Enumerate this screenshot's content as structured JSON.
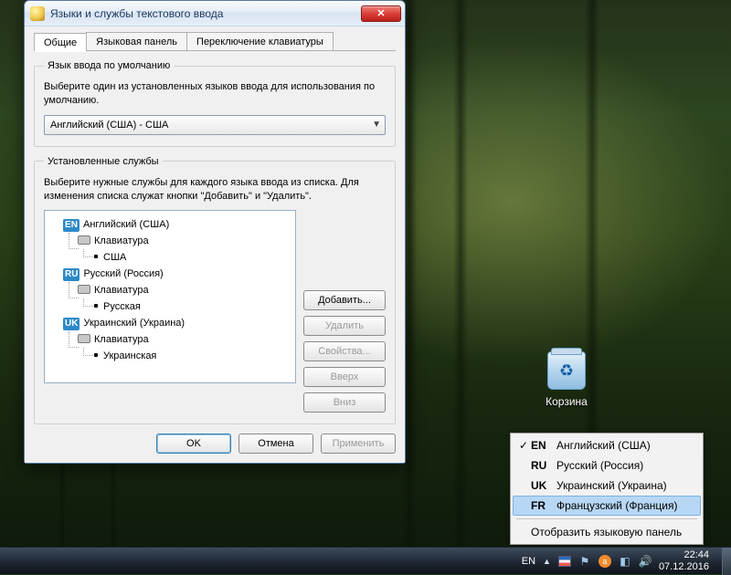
{
  "desktop": {
    "recycle_bin_label": "Корзина"
  },
  "dialog": {
    "title": "Языки и службы текстового ввода",
    "tabs": [
      "Общие",
      "Языковая панель",
      "Переключение клавиатуры"
    ],
    "active_tab": 0,
    "default_lang_group": {
      "legend": "Язык ввода по умолчанию",
      "desc": "Выберите один из установленных языков ввода для использования по умолчанию.",
      "combo_value": "Английский (США) - США"
    },
    "services_group": {
      "legend": "Установленные службы",
      "desc": "Выберите нужные службы для каждого языка ввода из списка. Для изменения списка служат кнопки \"Добавить\" и \"Удалить\".",
      "tree": [
        {
          "code": "EN",
          "name": "Английский (США)",
          "keyboard_label": "Клавиатура",
          "layout": "США"
        },
        {
          "code": "RU",
          "name": "Русский (Россия)",
          "keyboard_label": "Клавиатура",
          "layout": "Русская"
        },
        {
          "code": "UK",
          "name": "Украинский (Украина)",
          "keyboard_label": "Клавиатура",
          "layout": "Украинская"
        }
      ],
      "buttons": {
        "add": "Добавить...",
        "remove": "Удалить",
        "properties": "Свойства...",
        "up": "Вверх",
        "down": "Вниз"
      }
    },
    "footer": {
      "ok": "OK",
      "cancel": "Отмена",
      "apply": "Применить"
    }
  },
  "lang_menu": {
    "items": [
      {
        "code": "EN",
        "name": "Английский (США)",
        "checked": true
      },
      {
        "code": "RU",
        "name": "Русский (Россия)",
        "checked": false
      },
      {
        "code": "UK",
        "name": "Украинский (Украина)",
        "checked": false
      },
      {
        "code": "FR",
        "name": "Французский (Франция)",
        "checked": false,
        "hover": true
      }
    ],
    "show_panel": "Отобразить языковую панель"
  },
  "taskbar": {
    "lang_indicator": "EN",
    "time": "22:44",
    "date": "07.12.2016"
  }
}
